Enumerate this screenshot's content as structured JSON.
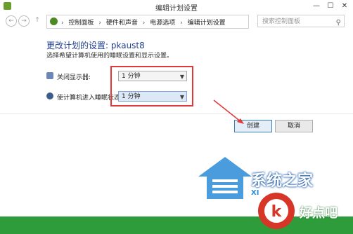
{
  "window": {
    "title": "编辑计划设置",
    "min_label": "—",
    "max_label": "☐",
    "close_label": "✕"
  },
  "nav": {
    "back_label": "←",
    "forward_label": "→",
    "up_label": "↑"
  },
  "breadcrumb": [
    "控制面板",
    "硬件和声音",
    "电源选项",
    "编辑计划设置"
  ],
  "search": {
    "placeholder": "搜索控制面板"
  },
  "main": {
    "title": "更改计划的设置: pkaust8",
    "subtitle": "选择希望计算机使用的睡眠设置和显示设置。",
    "settings": [
      {
        "label": "关闭显示器:",
        "value": "1 分钟"
      },
      {
        "label": "使计算机进入睡眠状态:",
        "value": "1 分钟"
      }
    ]
  },
  "buttons": {
    "create": "创建",
    "cancel": "取消"
  },
  "watermarks": {
    "site1": "系统之家",
    "site1_sub": "XI",
    "site2": "好点吧"
  },
  "colors": {
    "title_blue": "#1e3f8f",
    "annotation_red": "#e0393b",
    "band_green": "#2e9c3a"
  }
}
